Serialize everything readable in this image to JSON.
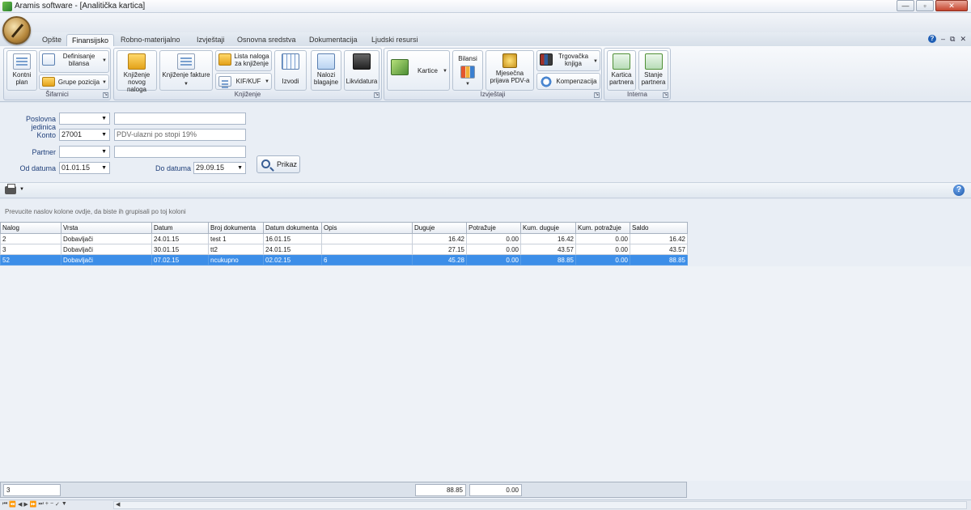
{
  "window": {
    "title": "Aramis software - [Analitička kartica]",
    "buttons": [
      "—",
      "▫",
      "✕"
    ]
  },
  "tabs": [
    "Opšte",
    "Finansijsko",
    "Robno-materijalno",
    "Izvještaji",
    "Osnovna sredstva",
    "Dokumentacija",
    "Ljudski resursi"
  ],
  "active_tab": "Finansijsko",
  "tab_right": {
    "minimize": "–",
    "restore": "⧉",
    "close": "✕",
    "help": "?"
  },
  "ribbon": {
    "groups": {
      "sifarnici": "Šifarnici",
      "knjizenje": "Knjiženje",
      "izvjestaji": "Izvještaji",
      "interna": "Interna"
    },
    "buttons": {
      "kontni_plan": "Kontni plan",
      "definisanje_bilansa": "Definisanje bilansa",
      "grupe_pozicija": "Grupe pozicija",
      "knjizenje_novog_naloga": "Knjiženje novog naloga",
      "knjizenje_fakture": "Knjiženje fakture",
      "lista_naloga": "Lista naloga za knjiženje",
      "kif_kuf": "KIF/KUF",
      "izvodi": "Izvodi",
      "nalozi_blagajne": "Nalozi blagajne",
      "likvidatura": "Likvidatura",
      "kartice": "Kartice",
      "bilansi": "Bilansi",
      "mjesecna_prijava": "Mjesečna prijava PDV-a",
      "trgovacka_knjiga": "Trgovačka knjiga",
      "kompenzacija": "Kompenzacija",
      "kartica_partnera": "Kartica partnera",
      "stanje_partnera": "Stanje partnera"
    }
  },
  "form": {
    "poslovna_jedinica": {
      "label": "Poslovna jedinica",
      "value": "",
      "desc": ""
    },
    "konto": {
      "label": "Konto",
      "value": "27001",
      "desc": "PDV-ulazni po stopi 19%"
    },
    "partner": {
      "label": "Partner",
      "value": "",
      "desc": ""
    },
    "od_datuma": {
      "label": "Od datuma",
      "value": "01.01.15"
    },
    "do_datuma": {
      "label": "Do datuma",
      "value": "29.09.15"
    },
    "prikaz": "Prikaz"
  },
  "grid": {
    "group_hint": "Prevucite naslov kolone ovdje, da biste ih grupisali po toj koloni",
    "columns": [
      "Nalog",
      "Vrsta",
      "Datum",
      "Broj dokumenta",
      "Datum dokumenta",
      "Opis",
      "Duguje",
      "Potražuje",
      "Kum. duguje",
      "Kum. potražuje",
      "Saldo"
    ],
    "rows": [
      [
        "2",
        "Dobavljači",
        "24.01.15",
        "test 1",
        "16.01.15",
        "",
        "16.42",
        "0.00",
        "16.42",
        "0.00",
        "16.42"
      ],
      [
        "3",
        "Dobavljači",
        "30.01.15",
        "tt2",
        "24.01.15",
        "",
        "27.15",
        "0.00",
        "43.57",
        "0.00",
        "43.57"
      ],
      [
        "52",
        "Dobavljači",
        "07.02.15",
        "ncukupno",
        "02.02.15",
        "6",
        "45.28",
        "0.00",
        "88.85",
        "0.00",
        "88.85"
      ]
    ],
    "selected_row": 2,
    "footer": {
      "count": "3",
      "duguje_total": "88.85",
      "potrazuje_total": "0.00"
    }
  }
}
